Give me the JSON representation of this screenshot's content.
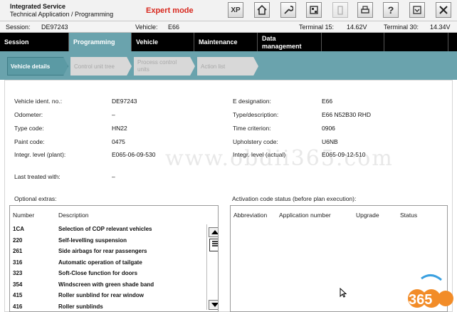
{
  "app": {
    "title_line1": "Integrated Service",
    "title_line2": "Technical Application / Programming",
    "mode": "Expert mode"
  },
  "toolbar": {
    "xp_label": "XP"
  },
  "session": {
    "session_label": "Session:",
    "session_value": "DE97243",
    "vehicle_label": "Vehicle:",
    "vehicle_value": "E66",
    "t15_label": "Terminal 15:",
    "t15_value": "14.62V",
    "t30_label": "Terminal 30:",
    "t30_value": "14.34V"
  },
  "nav": {
    "tabs": [
      {
        "label": "Session"
      },
      {
        "label": "Programming"
      },
      {
        "label": "Vehicle"
      },
      {
        "label": "Maintenance"
      },
      {
        "label_line1": "Data",
        "label_line2": "management"
      }
    ]
  },
  "subnav": {
    "tabs": [
      {
        "label": "Vehicle details"
      },
      {
        "label": "Control unit tree"
      },
      {
        "label_line1": "Process control",
        "label_line2": "units"
      },
      {
        "label": "Action list"
      }
    ]
  },
  "details": {
    "left": [
      {
        "label": "Vehicle ident. no.:",
        "value": "DE97243"
      },
      {
        "label": "Odometer:",
        "value": "–"
      },
      {
        "label": "Type code:",
        "value": "HN22"
      },
      {
        "label": "Paint code:",
        "value": "0475"
      },
      {
        "label": "Integr. level (plant):",
        "value": "E065-06-09-530"
      },
      {
        "label": "Last treated with:",
        "value": "–"
      }
    ],
    "right": [
      {
        "label": "E designation:",
        "value": "E66"
      },
      {
        "label": "Type/description:",
        "value": "E66 N52B30 RHD"
      },
      {
        "label": "Time criterion:",
        "value": "0906"
      },
      {
        "label": "Upholstery code:",
        "value": "U6NB"
      },
      {
        "label": "Integr. level (actual)",
        "value": "E065-09-12-510"
      }
    ]
  },
  "optional_extras": {
    "heading": "Optional extras:",
    "col_number": "Number",
    "col_description": "Description",
    "rows": [
      {
        "number": "1CA",
        "description": "Selection of COP relevant vehicles"
      },
      {
        "number": "220",
        "description": "Self-levelling suspension"
      },
      {
        "number": "261",
        "description": "Side airbags for rear passengers"
      },
      {
        "number": "316",
        "description": "Automatic operation of tailgate"
      },
      {
        "number": "323",
        "description": "Soft-Close function for doors"
      },
      {
        "number": "354",
        "description": "Windscreen with green shade band"
      },
      {
        "number": "415",
        "description": "Roller sunblind for rear window"
      },
      {
        "number": "416",
        "description": "Roller sunblinds"
      }
    ]
  },
  "activation": {
    "heading": "Activation code status (before plan execution):",
    "col_abbreviation": "Abbreviation",
    "col_application": "Application number",
    "col_upgrade": "Upgrade",
    "col_status": "Status"
  },
  "watermark": "www.obdii365.com",
  "logo_text": "365",
  "colors": {
    "accent": "#6aa3ad",
    "mode_red": "#d8281e",
    "logo_orange": "#f28c28"
  }
}
